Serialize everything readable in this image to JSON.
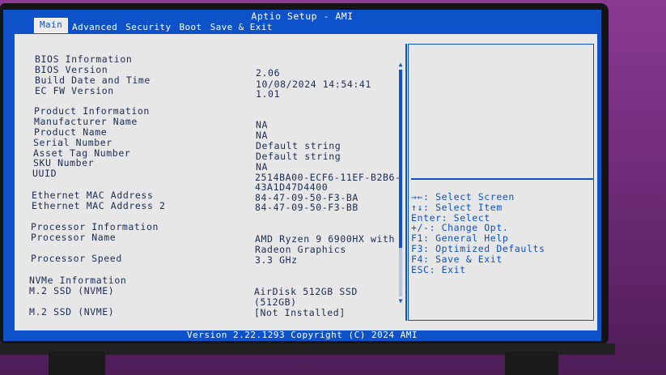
{
  "title": "Aptio Setup - AMI",
  "tabs": [
    "Main",
    "Advanced",
    "Security",
    "Boot",
    "Save & Exit"
  ],
  "main": {
    "rows": [
      {
        "label": "BIOS Information",
        "value": ""
      },
      {
        "label": "BIOS Version",
        "value": "2.06"
      },
      {
        "label": "Build Date and Time",
        "value": "10/08/2024 14:54:41"
      },
      {
        "label": "EC FW Version",
        "value": "1.01"
      },
      {
        "label": "Product Information",
        "value": ""
      },
      {
        "label": "Manufacturer Name",
        "value": "NA"
      },
      {
        "label": "Product Name",
        "value": "NA"
      },
      {
        "label": "Serial Number",
        "value": "Default string"
      },
      {
        "label": "Asset Tag Number",
        "value": "Default string"
      },
      {
        "label": "SKU Number",
        "value": "NA"
      },
      {
        "label": "UUID",
        "value": "2514BA00-ECF6-11EF-B2B6-"
      },
      {
        "label": "",
        "value": "43A1D47D4400"
      },
      {
        "label": "Ethernet MAC Address",
        "value": "84-47-09-50-F3-BA"
      },
      {
        "label": "Ethernet MAC Address 2",
        "value": "84-47-09-50-F3-BB"
      },
      {
        "label": "Processor Information",
        "value": ""
      },
      {
        "label": "Processor Name",
        "value": "AMD Ryzen 9 6900HX with"
      },
      {
        "label": "",
        "value": "Radeon Graphics"
      },
      {
        "label": "Processor Speed",
        "value": "3.3 GHz"
      },
      {
        "label": "NVMe Information",
        "value": ""
      },
      {
        "label": "M.2 SSD (NVME)",
        "value": "AirDisk 512GB SSD"
      },
      {
        "label": "",
        "value": "(512GB)"
      },
      {
        "label": "M.2 SSD (NVME)",
        "value": "[Not Installed]"
      }
    ]
  },
  "help": [
    "→←: Select Screen",
    "↑↓: Select Item",
    "Enter: Select",
    "+/-: Change Opt.",
    "F1: General Help",
    "F3: Optimized Defaults",
    "F4: Save & Exit",
    "ESC: Exit"
  ],
  "footer": "Version 2.22.1293 Copyright (C) 2024 AMI",
  "icons": {
    "scroll_up": "scroll-up-arrow-icon",
    "scroll_down": "scroll-down-arrow-icon"
  },
  "colors": {
    "background_blue": "#0d52c8",
    "panel_gray": "#e7e7e7",
    "text": "#1a2b55"
  }
}
